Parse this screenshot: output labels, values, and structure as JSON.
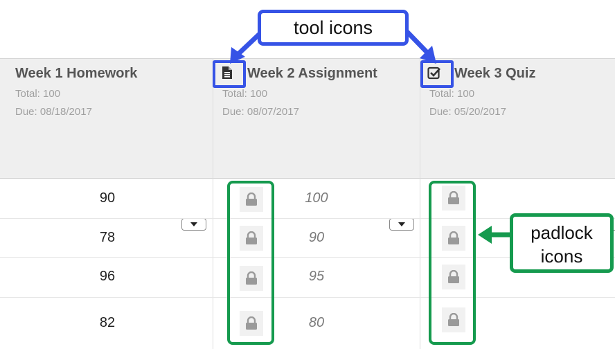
{
  "columns": [
    {
      "title": "Week 1 Homework",
      "total": "Total: 100",
      "due": "Due: 08/18/2017",
      "icon": "none"
    },
    {
      "title": "Week 2 Assignment",
      "total": "Total: 100",
      "due": "Due: 08/07/2017",
      "icon": "document-icon"
    },
    {
      "title": "Week 3 Quiz",
      "total": "Total: 100",
      "due": "Due: 05/20/2017",
      "icon": "checkbox-icon"
    }
  ],
  "rows": [
    {
      "week1": "90",
      "week2": "100"
    },
    {
      "week1": "78",
      "week2": "90"
    },
    {
      "week1": "96",
      "week2": "95"
    },
    {
      "week1": "82",
      "week2": "80"
    }
  ],
  "callouts": {
    "tool_icons": "tool icons",
    "padlock_line1": "padlock",
    "padlock_line2": "icons"
  },
  "colors": {
    "blue_highlight": "#3653e6",
    "green_highlight": "#159a4e",
    "header_bg": "#efefef"
  }
}
